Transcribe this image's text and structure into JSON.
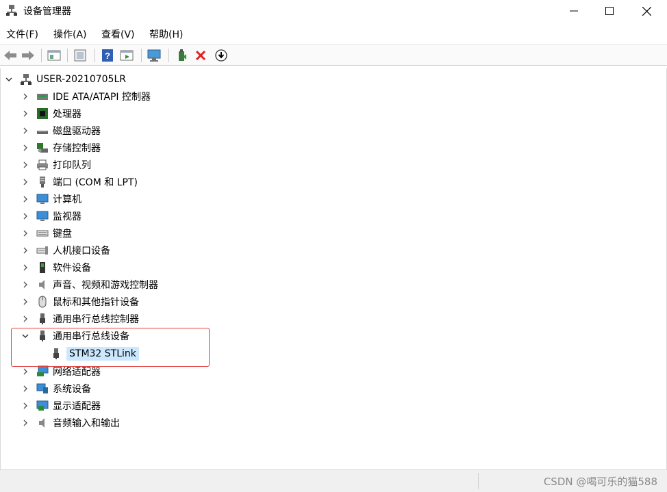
{
  "window": {
    "title": "设备管理器",
    "controls": {
      "minimize": "minimize",
      "maximize": "maximize",
      "close": "close"
    }
  },
  "menu": {
    "items": [
      "文件(F)",
      "操作(A)",
      "查看(V)",
      "帮助(H)"
    ]
  },
  "toolbar": {
    "icons": [
      "back-icon",
      "forward-icon",
      "properties-icon",
      "update-icon",
      "help-icon",
      "show-hidden-icon",
      "monitor-icon",
      "add-driver-icon",
      "uninstall-icon",
      "download-icon"
    ]
  },
  "tree": {
    "root": "USER-20210705LR",
    "categories": [
      {
        "label": "IDE ATA/ATAPI 控制器",
        "icon": "ide-icon",
        "expanded": false
      },
      {
        "label": "处理器",
        "icon": "processor-icon",
        "expanded": false
      },
      {
        "label": "磁盘驱动器",
        "icon": "disk-icon",
        "expanded": false
      },
      {
        "label": "存储控制器",
        "icon": "storage-icon",
        "expanded": false
      },
      {
        "label": "打印队列",
        "icon": "printer-icon",
        "expanded": false
      },
      {
        "label": "端口 (COM 和 LPT)",
        "icon": "port-icon",
        "expanded": false
      },
      {
        "label": "计算机",
        "icon": "computer-icon",
        "expanded": false
      },
      {
        "label": "监视器",
        "icon": "monitor-icon",
        "expanded": false
      },
      {
        "label": "键盘",
        "icon": "keyboard-icon",
        "expanded": false
      },
      {
        "label": "人机接口设备",
        "icon": "hid-icon",
        "expanded": false
      },
      {
        "label": "软件设备",
        "icon": "software-icon",
        "expanded": false
      },
      {
        "label": "声音、视频和游戏控制器",
        "icon": "speaker-icon",
        "expanded": false
      },
      {
        "label": "鼠标和其他指针设备",
        "icon": "mouse-icon",
        "expanded": false
      },
      {
        "label": "通用串行总线控制器",
        "icon": "usb-icon",
        "expanded": false
      },
      {
        "label": "通用串行总线设备",
        "icon": "usb-icon",
        "expanded": true,
        "children": [
          {
            "label": "STM32 STLink",
            "icon": "usb-icon",
            "selected": true
          }
        ]
      },
      {
        "label": "网络适配器",
        "icon": "network-icon",
        "expanded": false
      },
      {
        "label": "系统设备",
        "icon": "system-icon",
        "expanded": false
      },
      {
        "label": "显示适配器",
        "icon": "display-icon",
        "expanded": false
      },
      {
        "label": "音频输入和输出",
        "icon": "audio-icon",
        "expanded": false
      }
    ]
  },
  "status": {
    "watermark": "CSDN @喝可乐的猫588"
  },
  "colors": {
    "highlight_border": "#e0403a",
    "selection_bg": "#cce8ff"
  }
}
